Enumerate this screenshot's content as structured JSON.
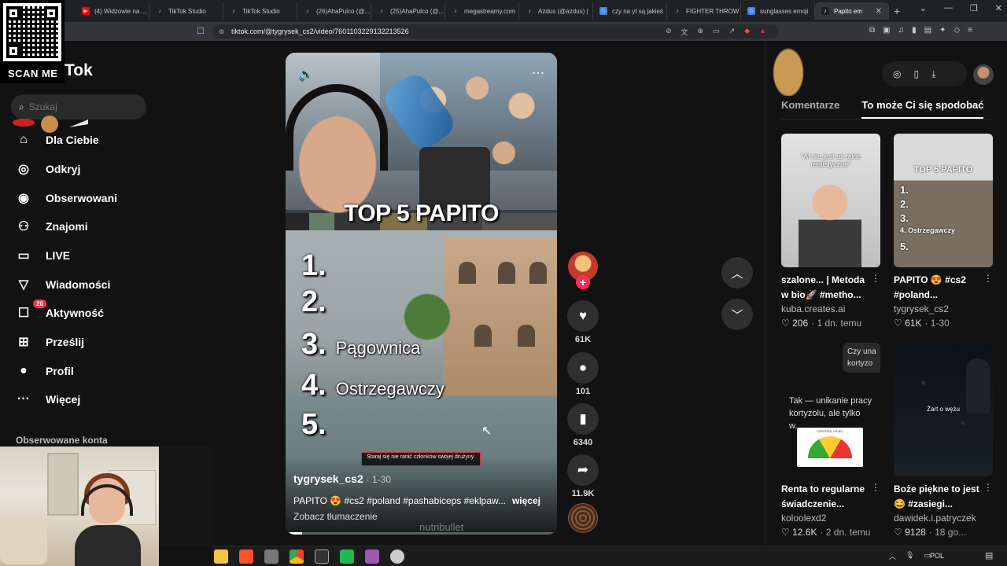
{
  "browser": {
    "tabs": [
      {
        "label": "(4) Widzowie na ...",
        "fav_color": "#ff0000",
        "fav_glyph": "▶"
      },
      {
        "label": "TikTok Studio",
        "fav_color": "#202124",
        "fav_glyph": "♪"
      },
      {
        "label": "TikTok Studio",
        "fav_color": "#202124",
        "fav_glyph": "♪"
      },
      {
        "label": "(26)AhaPulco (@...",
        "fav_color": "#202124",
        "fav_glyph": "♪"
      },
      {
        "label": "(25)AhaPulco (@...",
        "fav_color": "#202124",
        "fav_glyph": "♪"
      },
      {
        "label": "megastreamy.com",
        "fav_color": "#202124",
        "fav_glyph": "♪"
      },
      {
        "label": "Azdus (@azdus) |",
        "fav_color": "#202124",
        "fav_glyph": "♪"
      },
      {
        "label": "czy na yt są jakieś",
        "fav_color": "#4285f4",
        "fav_glyph": "G"
      },
      {
        "label": "FIGHTER THROW",
        "fav_color": "#202124",
        "fav_glyph": "♪"
      },
      {
        "label": "sunglasses emoji",
        "fav_color": "#4285f4",
        "fav_glyph": "G"
      },
      {
        "label": "Papito em",
        "fav_color": "#202124",
        "fav_glyph": "♪",
        "active": true
      }
    ],
    "new_tab_glyph": "+",
    "window_controls": [
      "⌄",
      "—",
      "❐",
      "✕"
    ],
    "url": "tiktok.com/@tygrysek_cs2/video/7601103229132213526"
  },
  "overlay": {
    "qr_label": "SCAN ME"
  },
  "sidebar": {
    "logo_partial": "Tok",
    "search_placeholder": "Szukaj",
    "items": [
      {
        "label": "Dla Ciebie",
        "icon": "home-icon",
        "glyph": "⌂"
      },
      {
        "label": "Odkryj",
        "icon": "compass-icon",
        "glyph": "◎"
      },
      {
        "label": "Obserwowani",
        "icon": "following-icon",
        "glyph": "◉"
      },
      {
        "label": "Znajomi",
        "icon": "friends-icon",
        "glyph": "⚇"
      },
      {
        "label": "LIVE",
        "icon": "live-icon",
        "glyph": "▭"
      },
      {
        "label": "Wiadomości",
        "icon": "messages-icon",
        "glyph": "▽"
      },
      {
        "label": "Aktywność",
        "icon": "activity-icon",
        "glyph": "☐",
        "badge": "26"
      },
      {
        "label": "Prześlij",
        "icon": "upload-icon",
        "glyph": "⊞"
      },
      {
        "label": "Profil",
        "icon": "profile-icon",
        "glyph": "●"
      },
      {
        "label": "Więcej",
        "icon": "more-icon",
        "glyph": "···"
      }
    ],
    "followed_title": "Obserwowane konta"
  },
  "video": {
    "title": "TOP 5 PAPITO",
    "ranks": [
      {
        "num": "1.",
        "name": ""
      },
      {
        "num": "2.",
        "name": ""
      },
      {
        "num": "3.",
        "name": "Pągownica"
      },
      {
        "num": "4.",
        "name": "Ostrzegawczy"
      },
      {
        "num": "5.",
        "name": ""
      }
    ],
    "subtitle": "Staraj się nie ranić członków swojej drużyny.",
    "author": "tygrysek_cs2",
    "date": "· 1-30",
    "description": "PAPITO 😍 #cs2 #poland #pashabiceps #eklpaw...",
    "more": "więcej",
    "translate": "Zobacz tłumaczenie",
    "sponsor_text": "nutribullet",
    "progress": 0.06
  },
  "actions": {
    "likes": "61K",
    "comments": "101",
    "saves": "6340",
    "shares": "11.9K"
  },
  "right_panel": {
    "tabs": [
      "Komentarze",
      "To może Ci się spodobać"
    ],
    "active_tab": 1,
    "cards": [
      {
        "title": "szalone... | Metoda w bio🚀 #metho...",
        "author": "kuba.creates.ai",
        "likes": "206",
        "meta": "· 1 dn. temu",
        "thumb_caption": "\"AI nie jest aż takie realistyczne\"",
        "thumb_bg": "#d8d8d8"
      },
      {
        "title": "PAPITO 😍 #cs2 #poland...",
        "author": "tygrysek_cs2",
        "likes": "61K",
        "meta": "· 1-30",
        "thumb_caption": "TOP 5 PAPITO",
        "thumb_bg": "#6b6e72",
        "thumb_list": [
          "1.",
          "2.",
          "3.",
          "4. Ostrzegawczy",
          "5."
        ]
      },
      {
        "title": "Renta to regularne świadczenie...",
        "author": "koloolexd2",
        "likes": "12.6K",
        "meta": "· 2 dn. temu",
        "thumb_caption": "Tak — unikanie pracy kortyzolu, ale tylko w...",
        "thumb_bubble": "Czy una kortyzo",
        "thumb_bg": "#121212",
        "gauge_label": "CORTISOL LEVEL"
      },
      {
        "title": "Boże piękne to jest😂 #zasiegi...",
        "author": "dawidek.i.patryczek",
        "likes": "9128",
        "meta": "· 18 go...",
        "thumb_caption": "Żart o wężu",
        "thumb_bg": "#0f1418"
      }
    ]
  },
  "taskbar": {
    "lang": "POL"
  }
}
